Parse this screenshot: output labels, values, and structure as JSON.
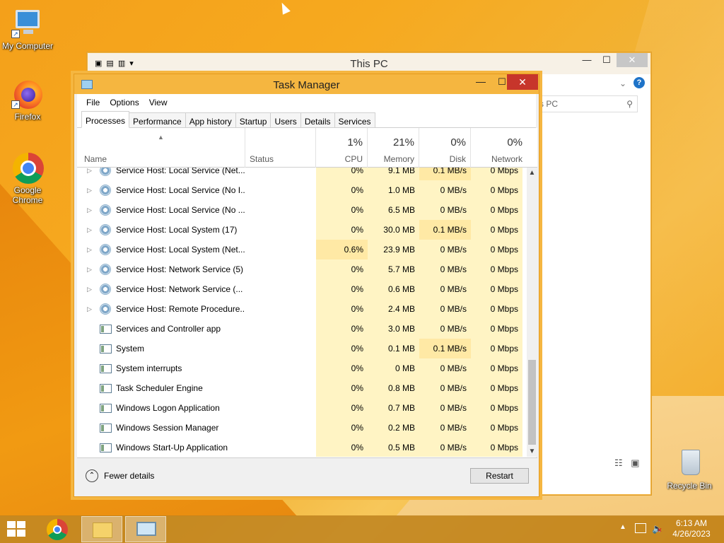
{
  "desktop": {
    "icons": [
      {
        "label": "My Computer"
      },
      {
        "label": "Firefox"
      },
      {
        "label": "Google Chrome"
      },
      {
        "label": "Recycle Bin"
      }
    ]
  },
  "explorer": {
    "title": "This PC",
    "search_placeholder": "Search This PC",
    "search_visible": "s PC",
    "minimize": "—",
    "maximize": "☐",
    "close": "✕"
  },
  "taskmanager": {
    "title": "Task Manager",
    "minimize": "—",
    "maximize": "☐",
    "close": "✕",
    "menu": [
      "File",
      "Options",
      "View"
    ],
    "tabs": [
      "Processes",
      "Performance",
      "App history",
      "Startup",
      "Users",
      "Details",
      "Services"
    ],
    "active_tab": "Processes",
    "columns": {
      "name": "Name",
      "status": "Status",
      "cpu": {
        "pct": "1%",
        "label": "CPU"
      },
      "memory": {
        "pct": "21%",
        "label": "Memory"
      },
      "disk": {
        "pct": "0%",
        "label": "Disk"
      },
      "network": {
        "pct": "0%",
        "label": "Network"
      }
    },
    "processes": [
      {
        "name": "Service Host: Local Service (Net...",
        "cpu": "0%",
        "memory": "9.1 MB",
        "disk": "0.1 MB/s",
        "network": "0 Mbps",
        "type": "service",
        "expandable": true
      },
      {
        "name": "Service Host: Local Service (No I...",
        "cpu": "0%",
        "memory": "1.0 MB",
        "disk": "0 MB/s",
        "network": "0 Mbps",
        "type": "service",
        "expandable": true
      },
      {
        "name": "Service Host: Local Service (No ...",
        "cpu": "0%",
        "memory": "6.5 MB",
        "disk": "0 MB/s",
        "network": "0 Mbps",
        "type": "service",
        "expandable": true
      },
      {
        "name": "Service Host: Local System (17)",
        "cpu": "0%",
        "memory": "30.0 MB",
        "disk": "0.1 MB/s",
        "network": "0 Mbps",
        "type": "service",
        "expandable": true
      },
      {
        "name": "Service Host: Local System (Net...",
        "cpu": "0.6%",
        "memory": "23.9 MB",
        "disk": "0 MB/s",
        "network": "0 Mbps",
        "type": "service",
        "expandable": true
      },
      {
        "name": "Service Host: Network Service (5)",
        "cpu": "0%",
        "memory": "5.7 MB",
        "disk": "0 MB/s",
        "network": "0 Mbps",
        "type": "service",
        "expandable": true
      },
      {
        "name": "Service Host: Network Service (...",
        "cpu": "0%",
        "memory": "0.6 MB",
        "disk": "0 MB/s",
        "network": "0 Mbps",
        "type": "service",
        "expandable": true
      },
      {
        "name": "Service Host: Remote Procedure...",
        "cpu": "0%",
        "memory": "2.4 MB",
        "disk": "0 MB/s",
        "network": "0 Mbps",
        "type": "service",
        "expandable": true
      },
      {
        "name": "Services and Controller app",
        "cpu": "0%",
        "memory": "3.0 MB",
        "disk": "0 MB/s",
        "network": "0 Mbps",
        "type": "app",
        "expandable": false
      },
      {
        "name": "System",
        "cpu": "0%",
        "memory": "0.1 MB",
        "disk": "0.1 MB/s",
        "network": "0 Mbps",
        "type": "app",
        "expandable": false
      },
      {
        "name": "System interrupts",
        "cpu": "0%",
        "memory": "0 MB",
        "disk": "0 MB/s",
        "network": "0 Mbps",
        "type": "app",
        "expandable": false
      },
      {
        "name": "Task Scheduler Engine",
        "cpu": "0%",
        "memory": "0.8 MB",
        "disk": "0 MB/s",
        "network": "0 Mbps",
        "type": "app",
        "expandable": false
      },
      {
        "name": "Windows Logon Application",
        "cpu": "0%",
        "memory": "0.7 MB",
        "disk": "0 MB/s",
        "network": "0 Mbps",
        "type": "app",
        "expandable": false
      },
      {
        "name": "Windows Session Manager",
        "cpu": "0%",
        "memory": "0.2 MB",
        "disk": "0 MB/s",
        "network": "0 Mbps",
        "type": "app",
        "expandable": false
      },
      {
        "name": "Windows Start-Up Application",
        "cpu": "0%",
        "memory": "0.5 MB",
        "disk": "0 MB/s",
        "network": "0 Mbps",
        "type": "app",
        "expandable": false
      }
    ],
    "footer": {
      "fewer_details": "Fewer details",
      "restart": "Restart"
    }
  },
  "taskbar": {
    "clock_time": "6:13 AM",
    "clock_date": "4/26/2023",
    "apps": [
      "start",
      "chrome",
      "file-explorer",
      "task-manager"
    ],
    "colors": {
      "accent": "#f5b640",
      "close": "#c7352b"
    }
  }
}
